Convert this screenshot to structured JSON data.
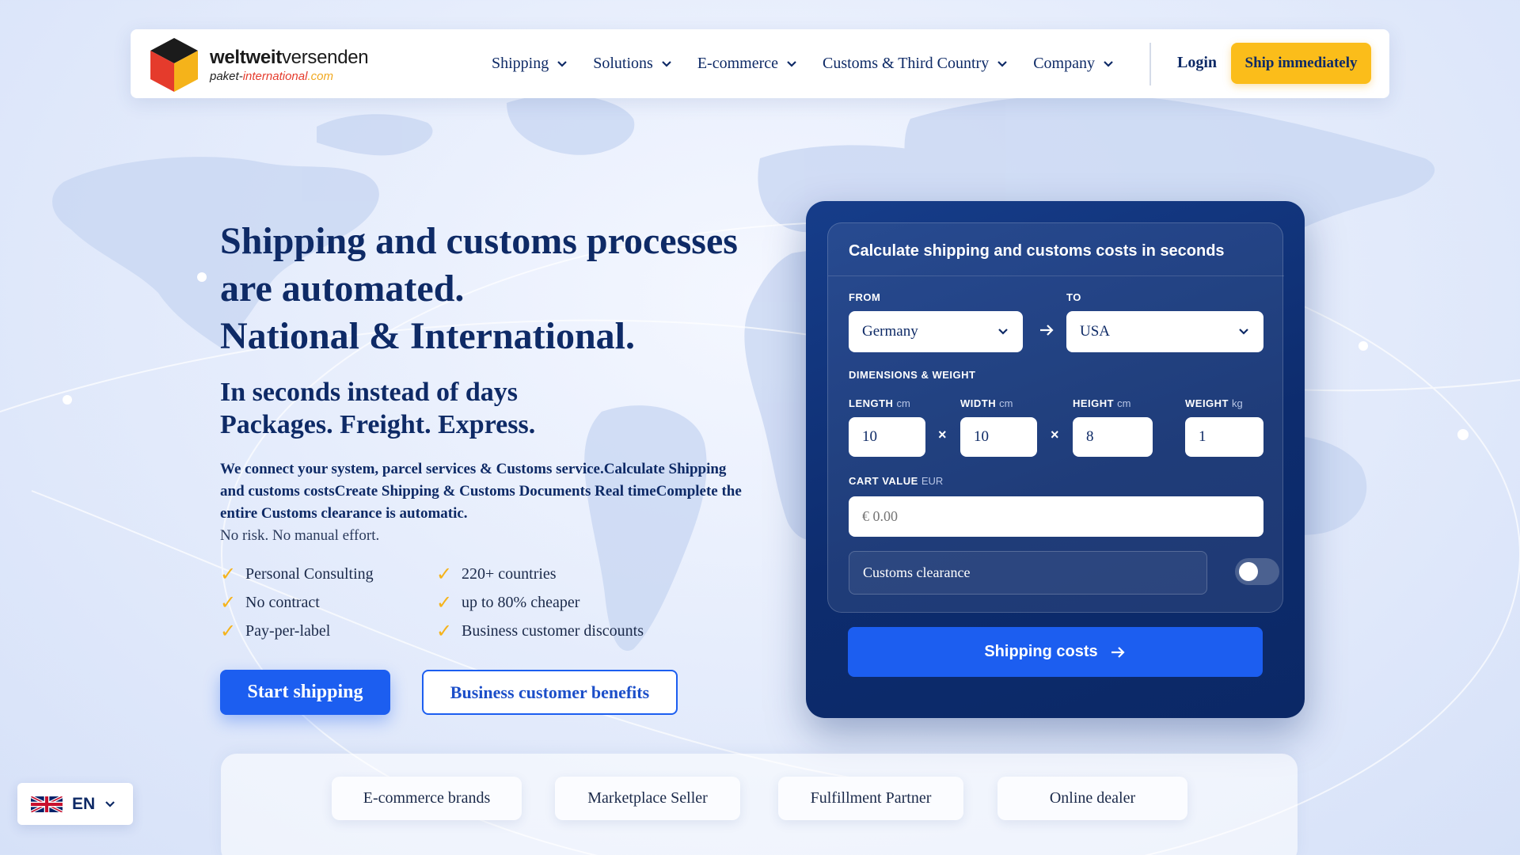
{
  "brand": {
    "name_bold": "weltweit",
    "name_regular": "versenden",
    "sub_prefix": "paket-",
    "sub_red": "international",
    "sub_suffix": ".com"
  },
  "nav": {
    "items": [
      {
        "label": "Shipping"
      },
      {
        "label": "Solutions"
      },
      {
        "label": "E-commerce"
      },
      {
        "label": "Customs & Third Country"
      },
      {
        "label": "Company"
      }
    ],
    "login": "Login",
    "cta": "Ship immediately"
  },
  "hero": {
    "title_line1": "Shipping and customs processes",
    "title_line2": "are automated.",
    "title_line3": "National & International.",
    "sub_line1": "In seconds instead of days",
    "sub_line2": "Packages. Freight. Express.",
    "desc_bold": "We connect your system, parcel services & Customs service.Calculate Shipping and customs costsCreate Shipping & Customs Documents Real timeComplete the entire Customs clearance is automatic.",
    "desc_normal": "No risk. No manual effort.",
    "features_left": [
      "Personal Consulting",
      "No contract",
      "Pay-per-label"
    ],
    "features_right": [
      "220+ countries",
      "up to 80% cheaper",
      "Business customer discounts"
    ],
    "check_glyph": "✓",
    "btn_primary": "Start shipping",
    "btn_secondary": "Business customer benefits"
  },
  "calculator": {
    "title": "Calculate shipping and customs costs in seconds",
    "from_label": "FROM",
    "to_label": "TO",
    "from_value": "Germany",
    "to_value": "USA",
    "dims_label": "DIMENSIONS & WEIGHT",
    "length_label": "LENGTH",
    "width_label": "WIDTH",
    "height_label": "HEIGHT",
    "weight_label": "WEIGHT",
    "unit_cm": "cm",
    "unit_kg": "kg",
    "length_value": "10",
    "width_value": "10",
    "height_value": "8",
    "weight_value": "1",
    "times_glyph": "×",
    "cart_label": "CART VALUE",
    "cart_unit": "EUR",
    "cart_placeholder": "€ 0.00",
    "customs_label": "Customs clearance",
    "customs_enabled": false,
    "submit": "Shipping costs"
  },
  "audience": {
    "chips": [
      "E-commerce brands",
      "Marketplace Seller",
      "Fulfillment Partner",
      "Online dealer"
    ]
  },
  "language": {
    "code": "EN",
    "flag": "uk-flag-icon"
  },
  "colors": {
    "primary": "#1c5ef0",
    "navy": "#0e2a66",
    "accent": "#fbbd1a"
  }
}
